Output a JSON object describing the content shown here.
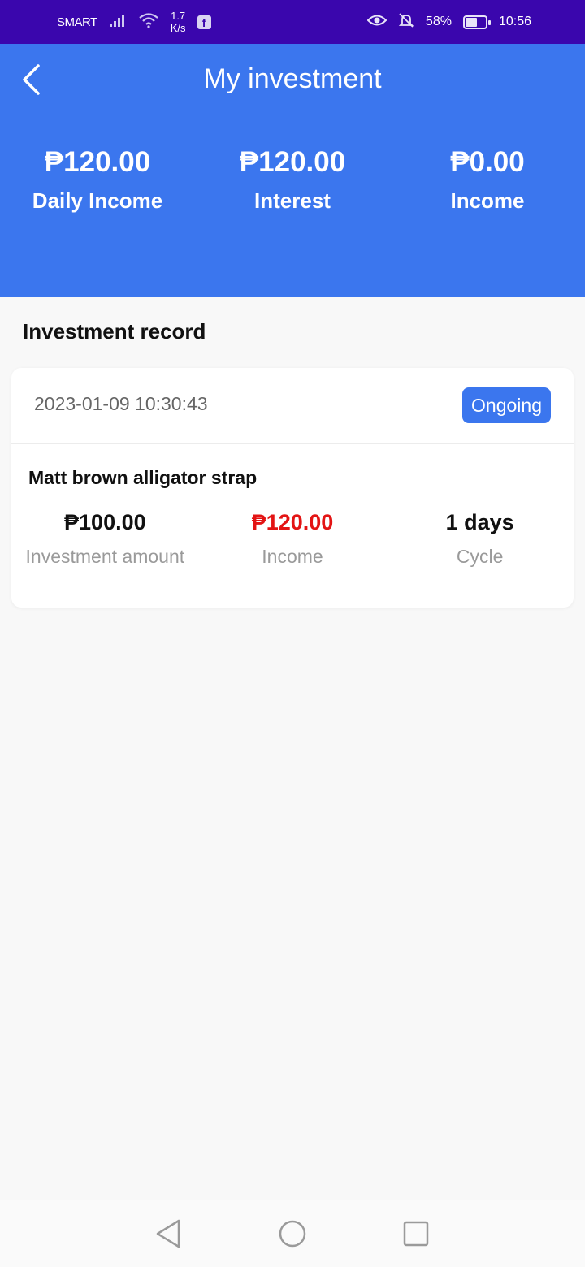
{
  "status_bar": {
    "carrier": "SMART",
    "speed_value": "1.7",
    "speed_unit": "K/s",
    "app_icon": "facebook-icon",
    "battery_percent": "58%",
    "battery_level": 0.58,
    "time": "10:56"
  },
  "header": {
    "title": "My investment",
    "back_icon": "chevron-left-icon",
    "stats": [
      {
        "value": "₱120.00",
        "label": "Daily Income"
      },
      {
        "value": "₱120.00",
        "label": "Interest"
      },
      {
        "value": "₱0.00",
        "label": "Income"
      }
    ]
  },
  "record": {
    "section_title": "Investment record",
    "items": [
      {
        "date": "2023-01-09 10:30:43",
        "status": "Ongoing",
        "product": "Matt brown alligator strap",
        "amount": {
          "value": "₱100.00",
          "label": "Investment amount"
        },
        "income": {
          "value": "₱120.00",
          "label": "Income"
        },
        "cycle": {
          "value": "1 days",
          "label": "Cycle"
        }
      }
    ]
  },
  "nav": {
    "back": "nav-back-icon",
    "home": "nav-home-icon",
    "recents": "nav-recents-icon"
  },
  "colors": {
    "status_bar": "#3a06ad",
    "header_bg": "#3b76ee",
    "accent": "#3b76ee",
    "income_red": "#e31414",
    "page_bg": "#f8f8f8"
  }
}
